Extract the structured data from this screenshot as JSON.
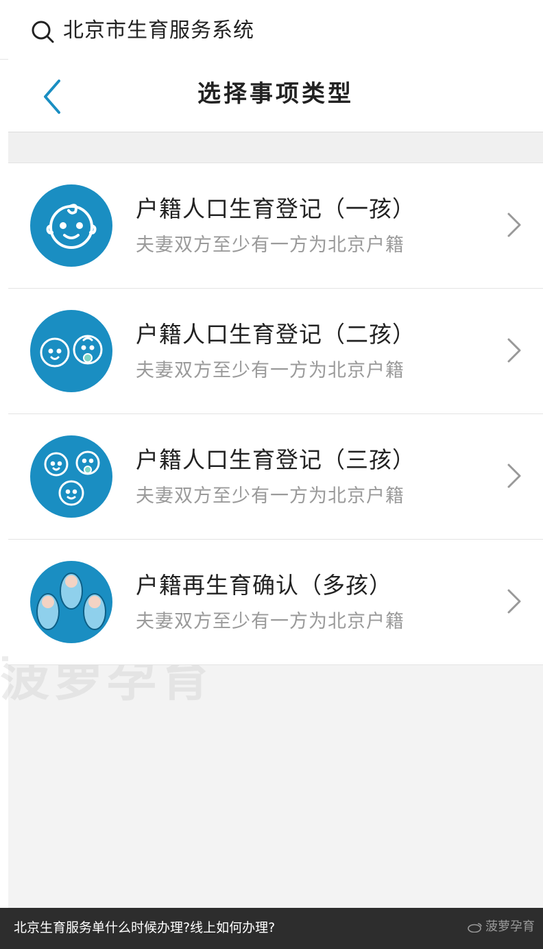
{
  "search": {
    "title": "北京市生育服务系统"
  },
  "nav": {
    "title": "选择事项类型"
  },
  "items": [
    {
      "title": "户籍人口生育登记（一孩）",
      "subtitle": "夫妻双方至少有一方为北京户籍",
      "icon": "one-baby-face-icon"
    },
    {
      "title": "户籍人口生育登记（二孩）",
      "subtitle": "夫妻双方至少有一方为北京户籍",
      "icon": "two-baby-faces-icon"
    },
    {
      "title": "户籍人口生育登记（三孩）",
      "subtitle": "夫妻双方至少有一方为北京户籍",
      "icon": "three-baby-faces-icon"
    },
    {
      "title": "户籍再生育确认（多孩）",
      "subtitle": "夫妻双方至少有一方为北京户籍",
      "icon": "swaddled-babies-icon"
    }
  ],
  "watermark": "菠萝孕育",
  "footer": {
    "caption": "北京生育服务单什么时候办理?线上如何办理?",
    "mark": "菠萝孕育"
  },
  "colors": {
    "accent": "#1a8ec2",
    "back": "#1a8ec2"
  }
}
